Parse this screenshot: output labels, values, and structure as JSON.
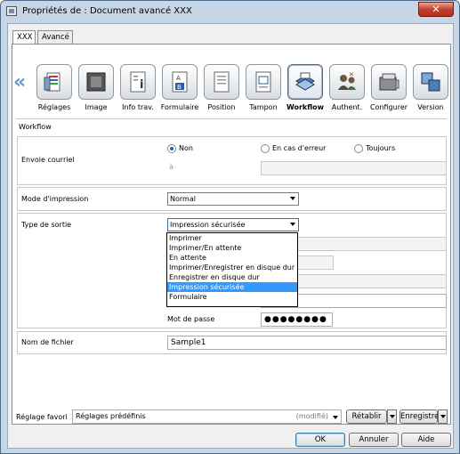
{
  "window": {
    "title": "Propriétés de : Document avancé XXX",
    "close": "✕"
  },
  "tabs": [
    {
      "label": "XXX"
    },
    {
      "label": "Avancé"
    }
  ],
  "toolbar": {
    "left_arrow": "«",
    "right_arrow": "»",
    "items": [
      {
        "label": "Réglages",
        "icon": "settings-icon"
      },
      {
        "label": "Image",
        "icon": "image-icon"
      },
      {
        "label": "Info trav.",
        "icon": "job-info-icon"
      },
      {
        "label": "Formulaire",
        "icon": "form-icon"
      },
      {
        "label": "Position",
        "icon": "position-icon"
      },
      {
        "label": "Tampon",
        "icon": "stamp-icon"
      },
      {
        "label": "Workflow",
        "icon": "workflow-icon",
        "selected": true
      },
      {
        "label": "Authent.",
        "icon": "authentication-icon"
      },
      {
        "label": "Configurer",
        "icon": "configure-icon"
      },
      {
        "label": "Version",
        "icon": "version-icon"
      }
    ]
  },
  "workflow": {
    "section_title": "Workflow",
    "email": {
      "label": "Envoie courriel",
      "options": [
        "Non",
        "En cas d'erreur",
        "Toujours"
      ],
      "selected": "Non",
      "to_label": "à",
      "to_value": ""
    },
    "print_mode": {
      "label": "Mode d'impression",
      "value": "Normal"
    },
    "output_type": {
      "label": "Type de sortie",
      "value": "Impression sécurisée",
      "options": [
        "Imprimer",
        "Imprimer/En attente",
        "En attente",
        "Imprimer/Enregistrer en disque dur",
        "Enregistrer en disque dur",
        "Impression sécurisée",
        "Formulaire"
      ]
    },
    "password": {
      "label": "Mot de passe",
      "value": "●●●●●●●●"
    },
    "file_name": {
      "label": "Nom de fichier",
      "value": "Sample1"
    }
  },
  "footer": {
    "favorite_label": "Réglage favori",
    "favorite_value": "Réglages prédéfinis",
    "modified": "(modifié)",
    "restore": "Rétablir",
    "save": "Enregistrer",
    "ok": "OK",
    "cancel": "Annuler",
    "help": "Aide"
  }
}
